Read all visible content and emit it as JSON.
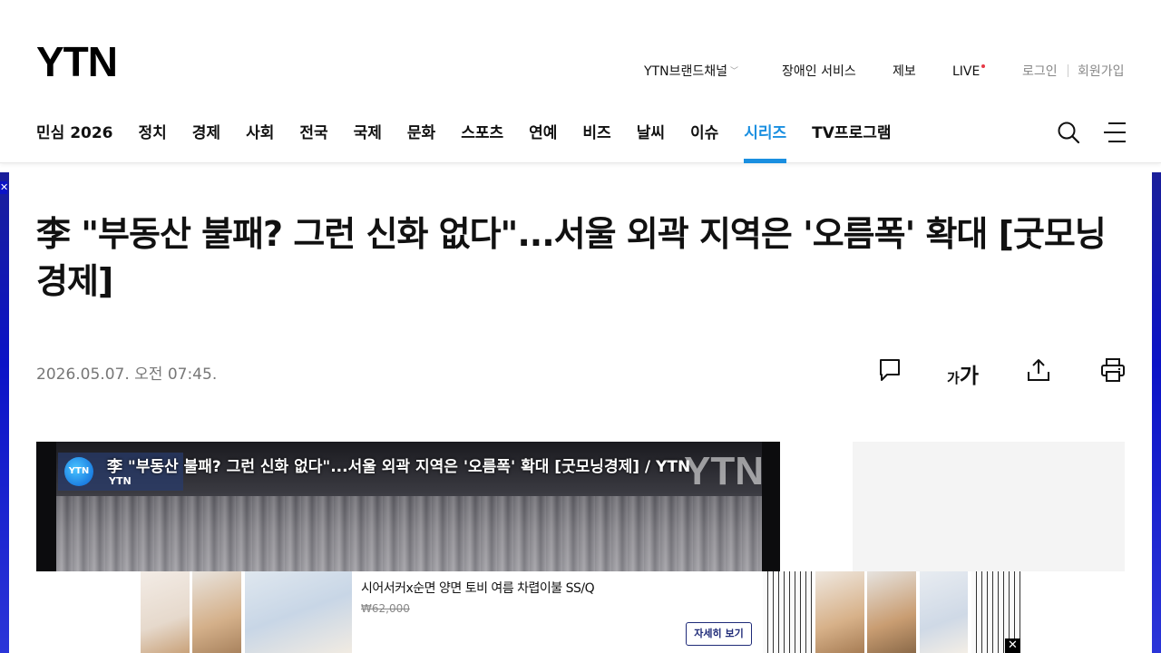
{
  "header": {
    "logo": "YTN",
    "util_links": {
      "brand_channel": "YTN브랜드채널",
      "accessibility": "장애인 서비스",
      "report": "제보",
      "live": "LIVE",
      "login": "로그인",
      "signup": "회원가입"
    },
    "nav": [
      {
        "label": "민심 2026"
      },
      {
        "label": "정치"
      },
      {
        "label": "경제"
      },
      {
        "label": "사회"
      },
      {
        "label": "전국"
      },
      {
        "label": "국제"
      },
      {
        "label": "문화"
      },
      {
        "label": "스포츠"
      },
      {
        "label": "연예"
      },
      {
        "label": "비즈"
      },
      {
        "label": "날씨"
      },
      {
        "label": "이슈"
      },
      {
        "label": "시리즈",
        "active": true
      },
      {
        "label": "TV프로그램"
      }
    ],
    "accent_color": "#1a8fe0"
  },
  "article": {
    "headline": "李 \"부동산 불패? 그런 신화 없다\"...서울 외곽 지역은 '오름폭' 확대 [굿모닝경제]",
    "date": "2026.05.07. 오전 07:45.",
    "tools": {
      "font_small": "가",
      "font_large": "가"
    }
  },
  "video": {
    "title": "李 \"부동산 불패? 그런 신화 없다\"...서울 외곽 지역은 '오름폭' 확대 [굿모닝경제] / YTN",
    "badge_logo": "YTN",
    "badge_text": "YTN",
    "watermark": "YTN"
  },
  "bottom_ad": {
    "title": "시어서커x순면 양면 토비 여름 차렵이불 SS/Q",
    "price": "₩62,000",
    "cta": "자세히 보기",
    "close": "✕"
  },
  "side_ad": {
    "close": "✕"
  }
}
